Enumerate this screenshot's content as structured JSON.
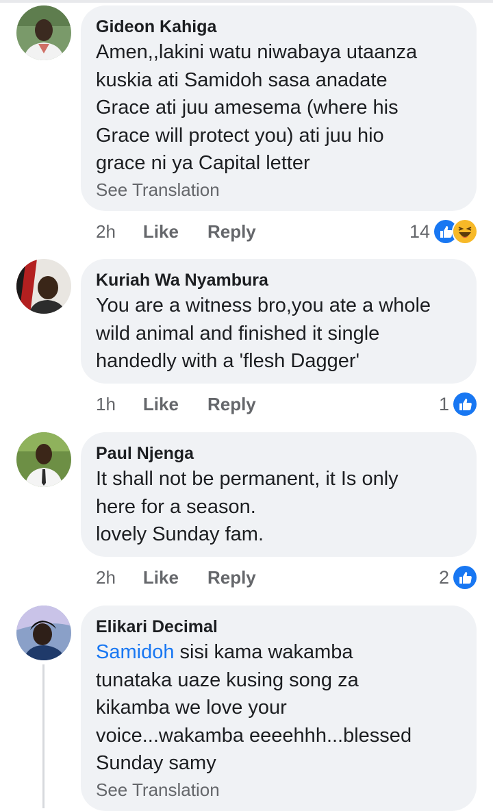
{
  "colors": {
    "bubble": "#f0f2f5",
    "meta": "#65676b",
    "link": "#1877f2",
    "like_blue": "#1877f2",
    "haha_yellow": "#f7b928"
  },
  "comments": [
    {
      "author": "Gideon Kahiga",
      "text": "Amen,,lakini watu niwabaya utaanza\nkuskia ati Samidoh sasa anadate\nGrace ati juu amesema (where his\nGrace will protect you) ati juu hio\ngrace ni ya Capital letter",
      "see_translation": "See Translation",
      "time": "2h",
      "like": "Like",
      "reply": "Reply",
      "reaction_count": "14",
      "reactions": [
        "like-icon",
        "haha-icon"
      ]
    },
    {
      "author": "Kuriah Wa Nyambura",
      "text": "You are a witness bro,you ate a whole\nwild animal and finished it single\nhandedly with a 'flesh Dagger'",
      "time": "1h",
      "like": "Like",
      "reply": "Reply",
      "reaction_count": "1",
      "reactions": [
        "like-icon"
      ]
    },
    {
      "author": "Paul Njenga",
      "text": "It shall not be permanent, it Is only\nhere for a season.\nlovely Sunday fam.",
      "time": "2h",
      "like": "Like",
      "reply": "Reply",
      "reaction_count": "2",
      "reactions": [
        "like-icon"
      ]
    },
    {
      "author": "Elikari Decimal",
      "mention": "Samidoh",
      "text": " sisi kama wakamba\ntunataka uaze kusing song za\nkikamba we love your\nvoice...wakamba eeeehhh...blessed\nSunday samy",
      "see_translation": "See Translation"
    }
  ]
}
